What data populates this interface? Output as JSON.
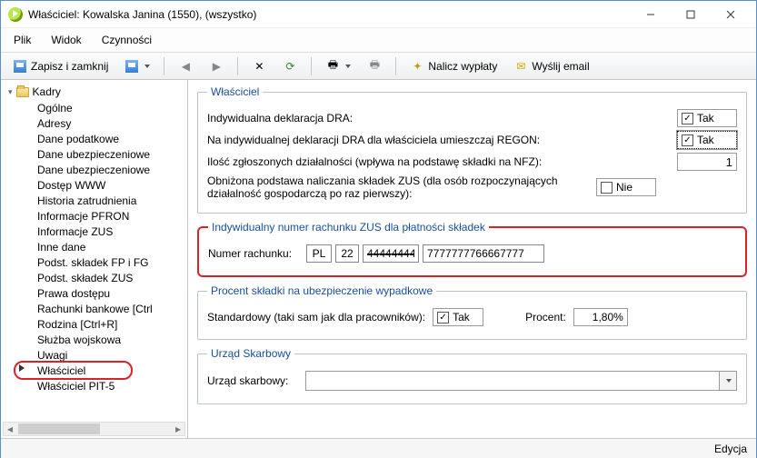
{
  "window": {
    "title": "Właściciel: Kowalska Janina (1550), (wszystko)"
  },
  "menu": {
    "file": "Plik",
    "view": "Widok",
    "actions": "Czynności"
  },
  "toolbar": {
    "save_close": "Zapisz i zamknij",
    "calc_payroll": "Nalicz wypłaty",
    "send_email": "Wyślij email"
  },
  "tree": {
    "root": "Kadry",
    "items": [
      {
        "label": "Ogólne"
      },
      {
        "label": "Adresy"
      },
      {
        "label": "Dane podatkowe"
      },
      {
        "label": "Dane ubezpieczeniowe"
      },
      {
        "label": "Dane ubezpieczeniowe"
      },
      {
        "label": "Dostęp WWW"
      },
      {
        "label": "Historia zatrudnienia"
      },
      {
        "label": "Informacje PFRON"
      },
      {
        "label": "Informacje ZUS"
      },
      {
        "label": "Inne dane"
      },
      {
        "label": "Podst. składek FP i FG"
      },
      {
        "label": "Podst. składek ZUS"
      },
      {
        "label": "Prawa dostępu"
      },
      {
        "label": "Rachunki bankowe [Ctrl"
      },
      {
        "label": "Rodzina [Ctrl+R]"
      },
      {
        "label": "Służba wojskowa"
      },
      {
        "label": "Uwagi"
      },
      {
        "label": "Właściciel",
        "selected": true
      },
      {
        "label": "Właściciel PIT-5"
      }
    ]
  },
  "owner_group": {
    "legend": "Właściciel",
    "dra_label": "Indywidualna deklaracja DRA:",
    "dra_value": "Tak",
    "regon_label": "Na indywidualnej deklaracji DRA dla właściciela umieszczaj REGON:",
    "regon_value": "Tak",
    "activities_label": "Ilość zgłoszonych działalności (wpływa na podstawę składki na NFZ):",
    "activities_value": "1",
    "reduced_label": "Obniżona podstawa naliczania składek ZUS (dla osób rozpoczynających działalność gospodarczą po raz pierwszy):",
    "reduced_value": "Nie"
  },
  "zus_account_group": {
    "legend": "Indywidualny numer rachunku ZUS dla płatności składek",
    "label": "Numer rachunku:",
    "country": "PL",
    "control": "22",
    "bank": "44444444",
    "account": "7777777766667777"
  },
  "accident_group": {
    "legend": "Procent składki na ubezpieczenie wypadkowe",
    "standard_label": "Standardowy (taki sam jak dla pracowników):",
    "standard_value": "Tak",
    "percent_label": "Procent:",
    "percent_value": "1,80%"
  },
  "tax_office_group": {
    "legend": "Urząd Skarbowy",
    "label": "Urząd skarbowy:",
    "value": ""
  },
  "status": {
    "mode": "Edycja"
  }
}
